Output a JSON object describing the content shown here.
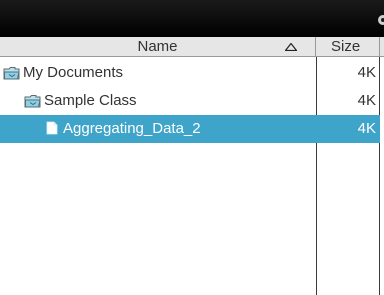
{
  "header": {
    "name_label": "Name",
    "size_label": "Size"
  },
  "files": [
    {
      "name": "My Documents",
      "size": "4K",
      "kind": "folder",
      "selected": false
    },
    {
      "name": "Sample Class",
      "size": "4K",
      "kind": "folder",
      "selected": false
    },
    {
      "name": "Aggregating_Data_2",
      "size": "4K",
      "kind": "file",
      "selected": true
    }
  ],
  "colors": {
    "selection": "#3fa4c9",
    "folder": "#8fd0e6"
  }
}
